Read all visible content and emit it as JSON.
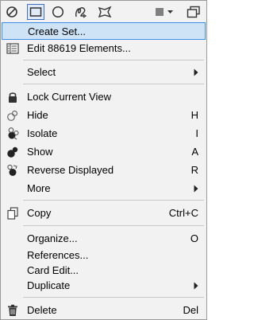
{
  "toolbar": {
    "icons": [
      {
        "name": "none-icon"
      },
      {
        "name": "rectangle-icon"
      },
      {
        "name": "circle-icon"
      },
      {
        "name": "freehand-icon"
      },
      {
        "name": "polygon-icon"
      },
      {
        "name": "color-square-icon"
      },
      {
        "name": "duplicate-window-icon"
      }
    ],
    "active_index": 1,
    "color_swatch": "#7f7f7f",
    "accent": "#3f6fbf"
  },
  "menu": {
    "highlight_color": "#cfe3f7",
    "highlight_border": "#3a8ee6",
    "items": {
      "create_set": {
        "label": "Create Set..."
      },
      "edit_elements": {
        "label": "Edit 88619 Elements..."
      },
      "select": {
        "label": "Select"
      },
      "lock_view": {
        "label": "Lock Current View"
      },
      "hide": {
        "label": "Hide",
        "shortcut": "H"
      },
      "isolate": {
        "label": "Isolate",
        "shortcut": "I"
      },
      "show": {
        "label": "Show",
        "shortcut": "A"
      },
      "reverse_displayed": {
        "label": "Reverse Displayed",
        "shortcut": "R"
      },
      "more": {
        "label": "More"
      },
      "copy": {
        "label": "Copy",
        "shortcut": "Ctrl+C"
      },
      "organize": {
        "label": "Organize...",
        "shortcut": "O"
      },
      "references": {
        "label": "References..."
      },
      "card_edit": {
        "label": "Card Edit..."
      },
      "duplicate": {
        "label": "Duplicate"
      },
      "delete": {
        "label": "Delete",
        "shortcut": "Del"
      }
    }
  }
}
